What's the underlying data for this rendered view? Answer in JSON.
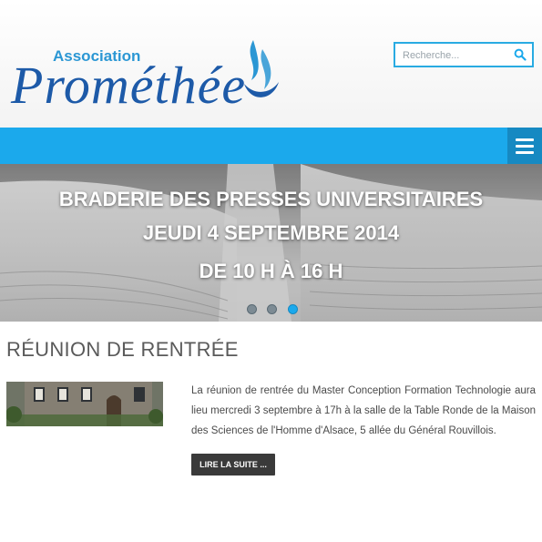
{
  "header": {
    "logo_small": "Association",
    "logo_big": "Prométhée",
    "search_placeholder": "Recherche..."
  },
  "slider": {
    "lines": [
      "BRADERIE DES PRESSES UNIVERSITAIRES",
      "JEUDI 4 SEPTEMBRE 2014",
      "DE 10 H À 16 H"
    ],
    "slide_count": 3,
    "active_slide": 3
  },
  "article": {
    "title": "RÉUNION DE RENTRÉE",
    "body": "La réunion de rentrée du Master Conception Formation Technologie aura lieu mercredi 3 septembre à 17h à la salle de la Table Ronde de la Maison des Sciences de l'Homme d'Alsace, 5 allée du Général Rouvillois.",
    "read_more": "LIRE LA SUITE ..."
  },
  "colors": {
    "accent": "#1ba9ec",
    "accent_dark": "#1689c2",
    "logo_blue": "#1d5aa8",
    "button_dark": "#3a3a3a"
  },
  "icons": {
    "search": "search-icon",
    "menu": "hamburger-menu-icon"
  }
}
